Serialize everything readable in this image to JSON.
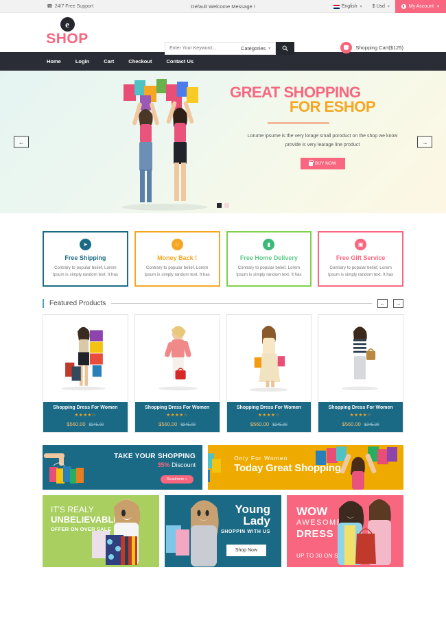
{
  "topbar": {
    "support": "24/7 Free Support",
    "support_icon": "phone-icon",
    "welcome": "Default Welcome Message !",
    "language": "English",
    "currency": "$ Usd",
    "account": "My Account"
  },
  "header": {
    "logo_mark": "e",
    "logo_text": "SHOP",
    "search_placeholder": "Enter Your Keyword...",
    "categories_label": "Categories",
    "search_icon": "search-icon",
    "cart_label": "Shopping Cart($125)"
  },
  "nav": {
    "items": [
      {
        "label": "Home"
      },
      {
        "label": "Login"
      },
      {
        "label": "Cart"
      },
      {
        "label": "Checkout"
      },
      {
        "label": "Contact Us"
      }
    ]
  },
  "hero": {
    "title_line1": "GREAT SHOPPING",
    "title_line2": "FOR ESHOP",
    "subtitle": "Lorume ipsume is the very lorage small poroduct on the shop we know provide is very learage line product",
    "button": "BUY NOW",
    "prev_icon": "arrow-left-icon",
    "next_icon": "arrow-right-icon",
    "slides": 2,
    "active_slide": 1
  },
  "services": [
    {
      "title": "Free Shipping",
      "desc": "Contrary to popular belief, Lorem Ipsum is simply random text. It has",
      "icon": "paper-plane-icon",
      "color": "#1b6a85"
    },
    {
      "title": "Money Back !",
      "desc": "Contrary to popular belief, Lorem Ipsum is simply random text. It has",
      "icon": "refresh-icon",
      "color": "#f5a623"
    },
    {
      "title": "Free Home Delivery",
      "desc": "Contrary to popular belief, Lorem Ipsum is simply random text. It has",
      "icon": "truck-icon",
      "color": "#5fc98a"
    },
    {
      "title": "Free Gift Service",
      "desc": "Contrary to popular belief, Lorem Ipsum is simply random text. It has",
      "icon": "gift-icon",
      "color": "#f8677f"
    }
  ],
  "featured": {
    "title": "Featured Products",
    "prev_icon": "arrow-left-icon",
    "next_icon": "arrow-right-icon",
    "products": [
      {
        "name": "Shopping Dress For Women",
        "stars": "★★★★☆",
        "price": "$560.00",
        "old_price": "$245.00"
      },
      {
        "name": "Shopping Dress For Women",
        "stars": "★★★★☆",
        "price": "$560.00",
        "old_price": "$245.00"
      },
      {
        "name": "Shopping Dress For Women",
        "stars": "★★★★☆",
        "price": "$560.00",
        "old_price": "$245.00"
      },
      {
        "name": "Shopping Dress For Women",
        "stars": "★★★★☆",
        "price": "$560.00",
        "old_price": "$245.00"
      }
    ]
  },
  "banner_row1": {
    "left": {
      "line1": "TAKE YOUR SHOPPING",
      "discount": "35%",
      "discount_suffix": " Discount",
      "button": "Readmore »"
    },
    "right": {
      "line1": "Only For Women",
      "line2": "Today Great Shopping"
    }
  },
  "banner_row2": [
    {
      "line1": "IT'S REALY",
      "line2": "UNBELIEVABLE",
      "line3": "OFFER ON OVER SALE"
    },
    {
      "line1": "Young",
      "line2": "Lady",
      "line3": "SHOPPIN WITH US",
      "button": "Shop Now"
    },
    {
      "line1": "WOW",
      "line2": "AWESOME",
      "line3": "DRESS",
      "line4": "UP TO 30 ON SASLE"
    }
  ],
  "colors": {
    "pink": "#f8677f",
    "orange": "#f5a623",
    "teal": "#1b6a85",
    "green": "#a8cf5f",
    "gold": "#efaa00",
    "dark": "#2b2d36"
  }
}
